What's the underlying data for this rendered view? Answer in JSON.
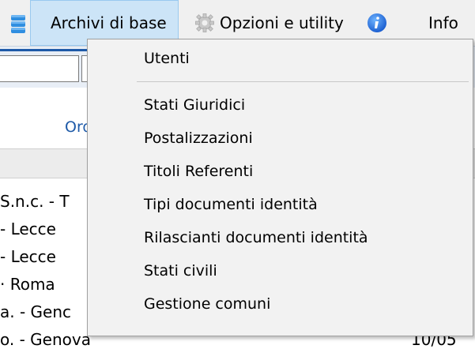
{
  "menubar": {
    "archivi_label": "Archivi di base",
    "opzioni_label": "Opzioni e utility",
    "info_label": "Info",
    "icons": [
      "database-icon",
      "gear-icon",
      "info-icon"
    ]
  },
  "background": {
    "order_label": "Ord",
    "rows": [
      "S.n.c.  - T",
      " - Lecce",
      " - Lecce",
      "· Roma",
      "a.  - Genc",
      "o.  - Genova"
    ],
    "right_fragment": "10/05"
  },
  "dropdown": {
    "items": [
      "Utenti",
      "Stati Giuridici",
      "Postalizzazioni",
      "Titoli Referenti",
      "Tipi documenti identità",
      "Rilascianti documenti identità",
      "Stati civili",
      "Gestione comuni"
    ]
  },
  "colors": {
    "menubar_bg": "#f0f0f0",
    "active_menu_bg": "#cce4f7",
    "dropdown_bg": "#f2f2f2",
    "accent_blue": "#1e5aa8"
  }
}
